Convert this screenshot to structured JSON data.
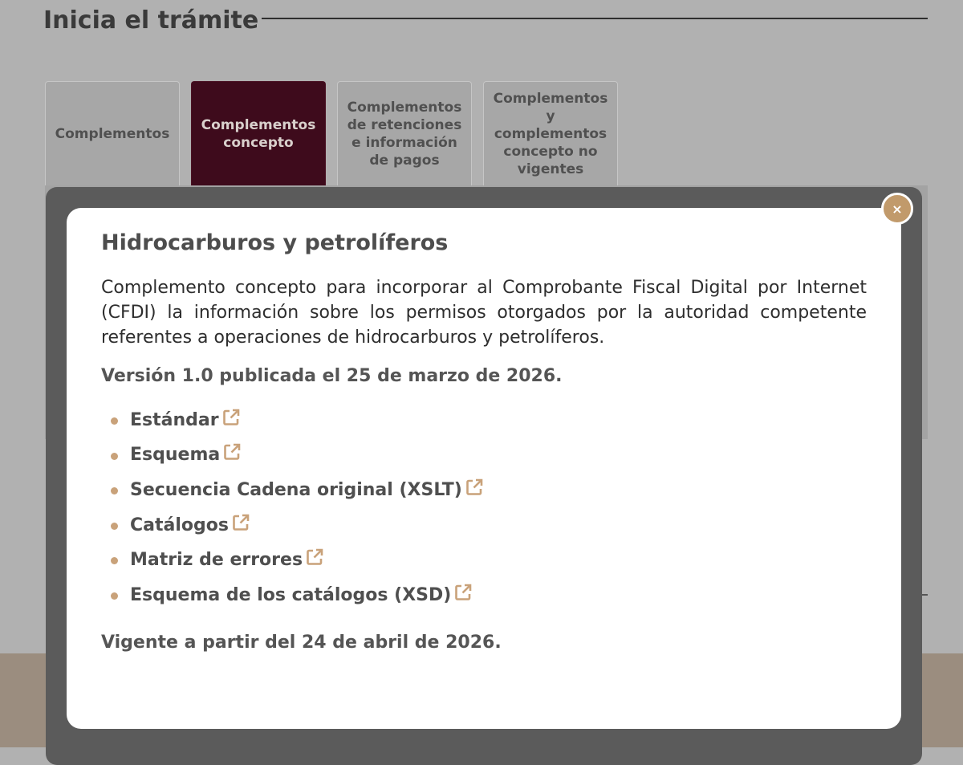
{
  "page": {
    "heading": "Inicia el trámite",
    "colors": {
      "accent_gold": "#c19a6b",
      "active_tab_bg": "#3e0b1c",
      "overlay_frame": "#5b5b5b",
      "footer_band": "#9b8d7f"
    }
  },
  "tabs": [
    {
      "label": "Complementos",
      "active": false
    },
    {
      "label": "Complementos concepto",
      "active": true
    },
    {
      "label": "Complementos de retenciones e información de pagos",
      "active": false
    },
    {
      "label": "Complementos y complementos concepto no vigentes",
      "active": false
    }
  ],
  "modal": {
    "close_label": "×",
    "title": "Hidrocarburos y petrolíferos",
    "description": "Complemento concepto para incorporar al Comprobante Fiscal Digital por Internet (CFDI) la información sobre los permisos otorgados por la autoridad competente referentes a operaciones de hidrocarburos y petrolíferos.",
    "version": "Versión 1.0 publicada el 25 de marzo de 2026.",
    "links": [
      {
        "label": "Estándar",
        "icon": "external-link-icon"
      },
      {
        "label": "Esquema",
        "icon": "external-link-icon"
      },
      {
        "label": "Secuencia Cadena original (XSLT)",
        "icon": "external-link-icon"
      },
      {
        "label": "Catálogos",
        "icon": "external-link-icon"
      },
      {
        "label": "Matriz de errores",
        "icon": "external-link-icon"
      },
      {
        "label": "Esquema de los catálogos (XSD)",
        "icon": "external-link-icon"
      }
    ],
    "validity": "Vigente a partir del 24 de abril de 2026."
  }
}
